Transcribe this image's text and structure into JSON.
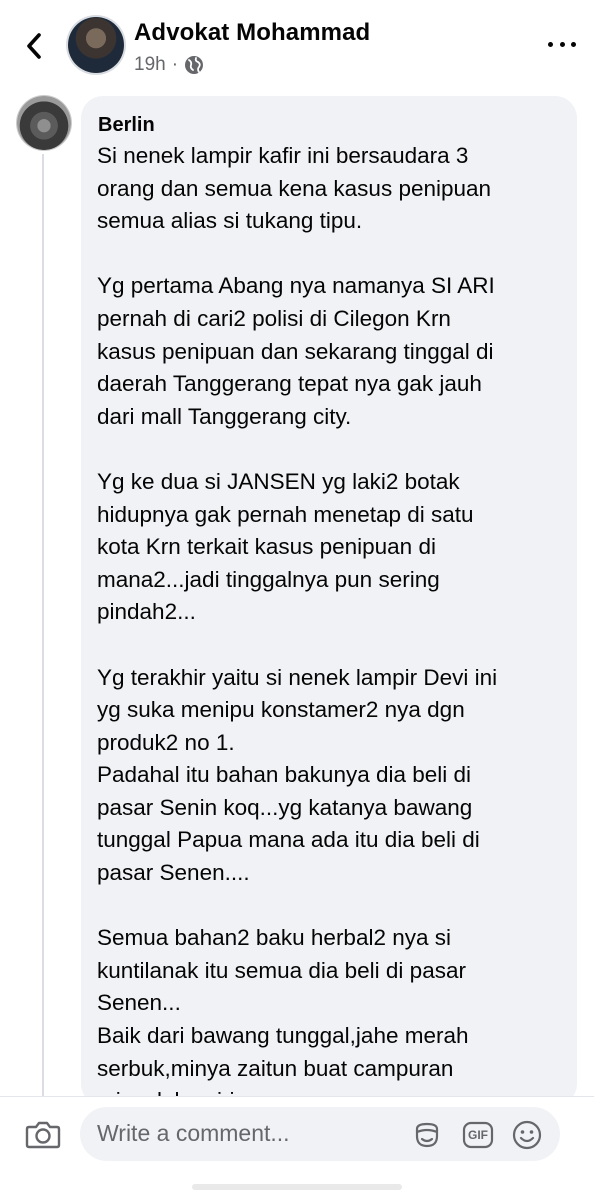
{
  "header": {
    "author_name": "Advokat Mohammad",
    "timestamp": "19h",
    "separator": "·",
    "privacy_icon": "globe-icon",
    "back_icon": "chevron-left-icon",
    "more_icon": "more-dots-icon"
  },
  "comment": {
    "author": "Berlin",
    "text": "Si nenek lampir kafir ini bersaudara 3\norang dan semua kena kasus penipuan\nsemua alias si tukang tipu.\n\nYg pertama Abang nya namanya SI ARI\npernah di cari2 polisi di Cilegon Krn\nkasus penipuan dan sekarang tinggal di\ndaerah Tanggerang tepat nya gak jauh\ndari mall Tanggerang city.\n\nYg ke dua si JANSEN yg laki2 botak\nhidupnya gak pernah menetap di satu\nkota Krn terkait kasus penipuan di\nmana2...jadi tinggalnya pun sering\npindah2...\n\nYg terakhir yaitu si nenek lampir Devi ini\nyg suka menipu konstamer2 nya dgn\nproduk2 no 1.\nPadahal itu bahan bakunya dia beli di\npasar Senin koq...yg katanya bawang\ntunggal Papua mana ada itu dia beli di\npasar Senen....\n\nSemua bahan2 baku herbal2 nya si\nkuntilanak itu semua dia beli di pasar\nSenen...\nBaik dari bawang tunggal,jahe merah\nserbuk,minya zaitun buat campuran\nminyak kemiri...."
  },
  "composer": {
    "placeholder": "Write a comment...",
    "camera_icon": "camera-icon",
    "avatar_sticker_icon": "avatar-sticker-icon",
    "gif_label": "GIF",
    "emoji_icon": "emoji-icon"
  },
  "colors": {
    "bubble": "#f0f2f5",
    "secondary_text": "#65676b",
    "primary_text": "#050505"
  }
}
